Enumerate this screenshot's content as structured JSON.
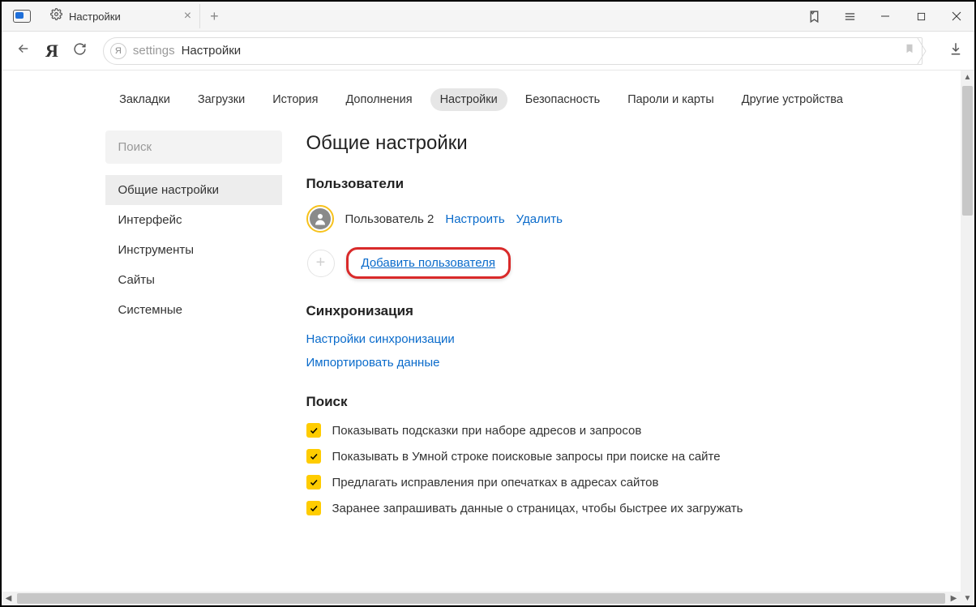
{
  "titlebar": {
    "tab_title": "Настройки"
  },
  "address": {
    "settings_text": "settings",
    "page_text": "Настройки"
  },
  "topnav": {
    "items": [
      "Закладки",
      "Загрузки",
      "История",
      "Дополнения",
      "Настройки",
      "Безопасность",
      "Пароли и карты",
      "Другие устройства"
    ],
    "active_index": 4
  },
  "sidebar": {
    "search_placeholder": "Поиск",
    "items": [
      "Общие настройки",
      "Интерфейс",
      "Инструменты",
      "Сайты",
      "Системные"
    ],
    "active_index": 0
  },
  "page": {
    "title": "Общие настройки",
    "users": {
      "heading": "Пользователи",
      "user_name": "Пользователь 2",
      "configure": "Настроить",
      "delete": "Удалить",
      "add_user": "Добавить пользователя"
    },
    "sync": {
      "heading": "Синхронизация",
      "settings_link": "Настройки синхронизации",
      "import_link": "Импортировать данные"
    },
    "search": {
      "heading": "Поиск",
      "opt1": "Показывать подсказки при наборе адресов и запросов",
      "opt2": "Показывать в Умной строке поисковые запросы при поиске на сайте",
      "opt3": "Предлагать исправления при опечатках в адресах сайтов",
      "opt4": "Заранее запрашивать данные о страницах, чтобы быстрее их загружать"
    }
  }
}
